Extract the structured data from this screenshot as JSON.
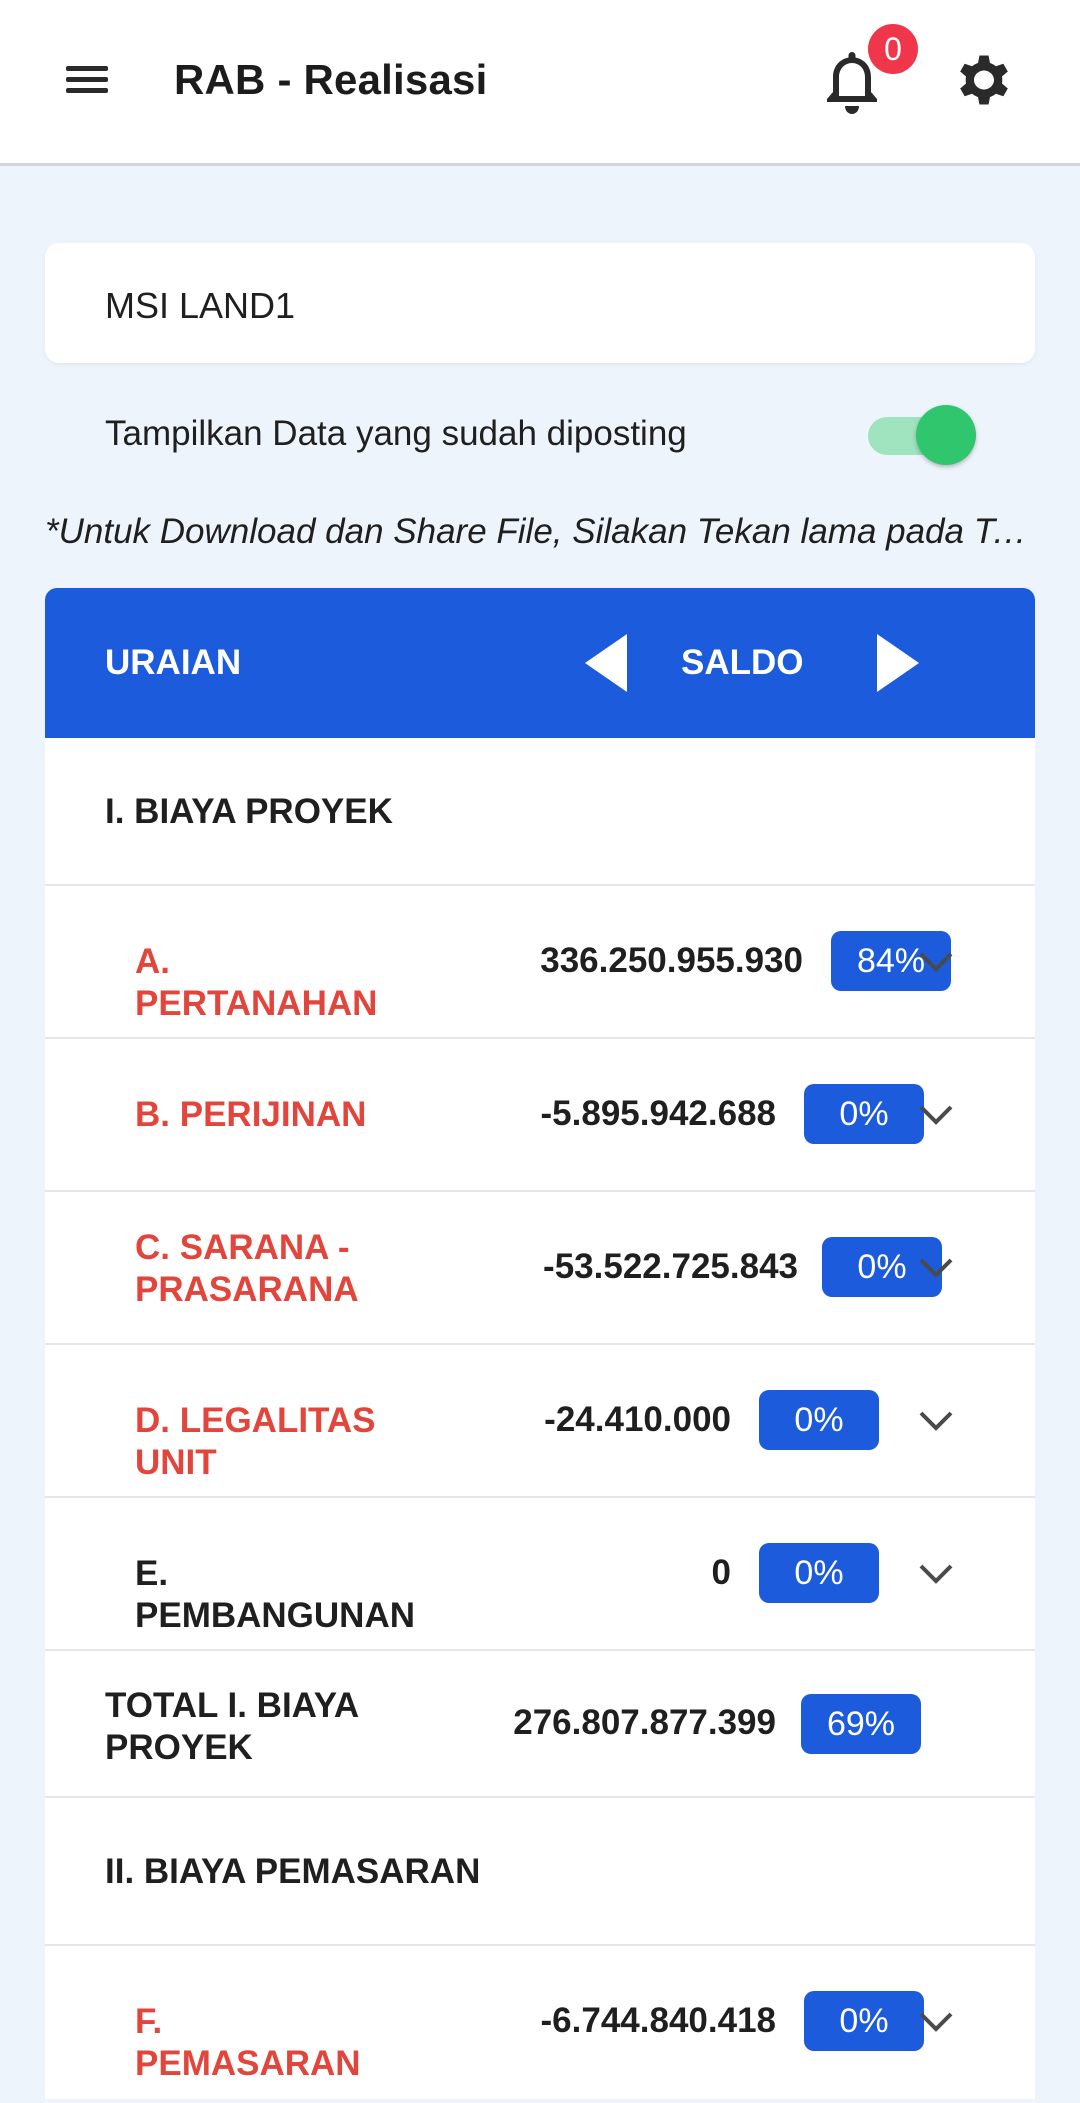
{
  "app": {
    "title": "RAB - Realisasi",
    "notification_count": "0"
  },
  "project": {
    "name": "MSI LAND1"
  },
  "filter": {
    "label": "Tampilkan Data yang sudah diposting",
    "enabled": true
  },
  "hint": "*Untuk Download dan Share File, Silakan Tekan lama pada Tab...",
  "table": {
    "header": {
      "col_uraian": "URAIAN",
      "col_saldo": "SALDO"
    },
    "sections": [
      {
        "title": "I. BIAYA PROYEK",
        "items": [
          {
            "label": "A. PERTANAHAN",
            "value": "336.250.955.930",
            "pct": "84%"
          },
          {
            "label": "B. PERIJINAN",
            "value": "-5.895.942.688",
            "pct": "0%"
          },
          {
            "label": "C. SARANA - PRASARANA",
            "value": "-53.522.725.843",
            "pct": "0%"
          },
          {
            "label": "D. LEGALITAS UNIT",
            "value": "-24.410.000",
            "pct": "0%"
          },
          {
            "label": "E. PEMBANGUNAN",
            "value": "0",
            "pct": "0%"
          }
        ],
        "total": {
          "label": "TOTAL I. BIAYA PROYEK",
          "value": "276.807.877.399",
          "pct": "69%"
        }
      },
      {
        "title": "II. BIAYA PEMASARAN",
        "items": [
          {
            "label": "F. PEMASARAN",
            "value": "-6.744.840.418",
            "pct": "0%"
          }
        ]
      }
    ]
  },
  "colors": {
    "primary": "#1b5bdc",
    "accent_red": "#e2453c",
    "badge": "#f0364b",
    "toggle_on": "#2fc66e",
    "background": "#eef4fb"
  }
}
